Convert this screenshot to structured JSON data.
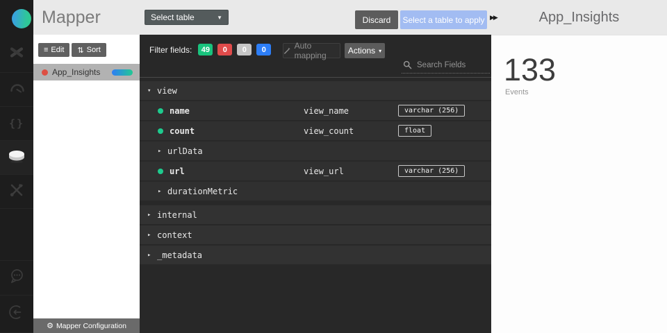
{
  "topbar": {
    "app_title": "Mapper",
    "select_table_label": "Select table",
    "discard_label": "Discard",
    "apply_label": "Select a table to apply",
    "table_title": "App_Insights"
  },
  "sidebar": {
    "items": [
      {
        "icon": "pipeline-icon",
        "active": false
      },
      {
        "icon": "dashboard-icon",
        "active": false
      },
      {
        "icon": "code-icon",
        "active": false
      },
      {
        "icon": "mapper-icon",
        "active": true
      },
      {
        "icon": "tools-icon",
        "active": false
      },
      {
        "icon": "chat-icon",
        "active": false
      },
      {
        "icon": "logout-icon",
        "active": false
      }
    ]
  },
  "left_panel": {
    "edit_label": "Edit",
    "sort_label": "Sort",
    "tables": [
      {
        "name": "App_Insights",
        "selected": true,
        "status_color": "#dd4f43",
        "progress_colors": [
          "#2f7df6",
          "#22c993"
        ]
      }
    ],
    "footer_label": "Mapper Configuration"
  },
  "main": {
    "filter_label": "Filter fields:",
    "filter_badges": [
      {
        "count": "49",
        "color": "#19c37d"
      },
      {
        "count": "0",
        "color": "#e04b4b"
      },
      {
        "count": "0",
        "color": "#c6c6c6"
      },
      {
        "count": "0",
        "color": "#2d7ef7"
      }
    ],
    "auto_mapping_label": "Auto mapping",
    "actions_label": "Actions",
    "search_placeholder": "Search Fields",
    "fields": [
      {
        "kind": "group",
        "state": "expanded",
        "label": "view",
        "indent": 0
      },
      {
        "kind": "field",
        "label": "name",
        "mapped": "view_name",
        "datatype": "varchar (256)",
        "indent": 1,
        "status_color": "#1ecb8e"
      },
      {
        "kind": "field",
        "label": "count",
        "mapped": "view_count",
        "datatype": "float",
        "indent": 1,
        "status_color": "#1ecb8e"
      },
      {
        "kind": "group",
        "state": "collapsed",
        "label": "urlData",
        "indent": 1
      },
      {
        "kind": "field",
        "label": "url",
        "mapped": "view_url",
        "datatype": "varchar (256)",
        "indent": 1,
        "status_color": "#1ecb8e"
      },
      {
        "kind": "group",
        "state": "collapsed",
        "label": "durationMetric",
        "indent": 1
      },
      {
        "kind": "gap"
      },
      {
        "kind": "group",
        "state": "collapsed",
        "label": "internal",
        "indent": 0
      },
      {
        "kind": "group",
        "state": "collapsed",
        "label": "context",
        "indent": 0
      },
      {
        "kind": "group",
        "state": "collapsed",
        "label": "_metadata",
        "indent": 0
      }
    ]
  },
  "right_panel": {
    "count": "133",
    "label": "Events"
  }
}
